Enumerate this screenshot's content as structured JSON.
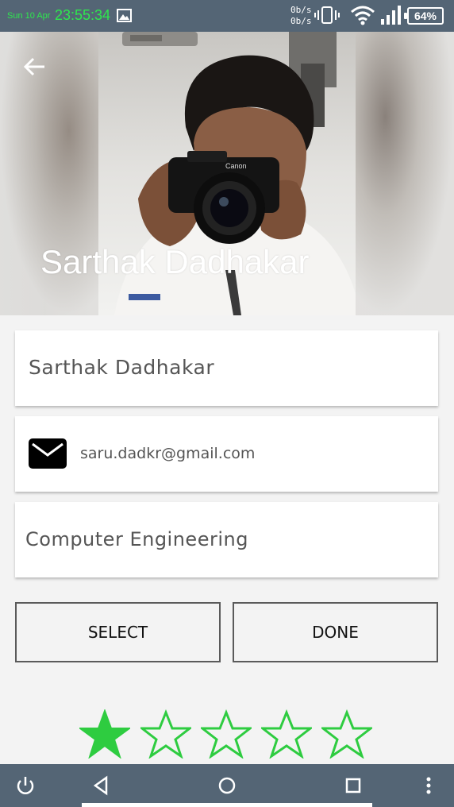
{
  "status_bar": {
    "date": "Sun 10 Apr",
    "time": "23:55:34",
    "net_up": "0b/s",
    "net_down": "0b/s",
    "battery": "64%",
    "icons": [
      "gallery-icon",
      "vibrate-icon",
      "wifi-icon",
      "signal-icon",
      "battery-icon"
    ]
  },
  "header": {
    "name": "Sarthak  Dadhakar",
    "back_icon": "arrow-left-icon"
  },
  "form": {
    "name_value": "Sarthak  Dadhakar",
    "email_value": "saru.dadkr@gmail.com",
    "email_icon": "mail-icon",
    "department_value": "Computer Engineering"
  },
  "buttons": {
    "select_label": "SELECT",
    "done_label": "DONE"
  },
  "rating": {
    "value": 1,
    "max": 5,
    "color": "#2ecc40"
  },
  "nav_bar": {
    "icons": [
      "power-icon",
      "back-triangle-icon",
      "home-circle-icon",
      "recents-square-icon",
      "more-vert-icon"
    ]
  },
  "colors": {
    "bars": "#546575",
    "status_clock": "#2ee84e",
    "background": "#f3f3f3"
  }
}
